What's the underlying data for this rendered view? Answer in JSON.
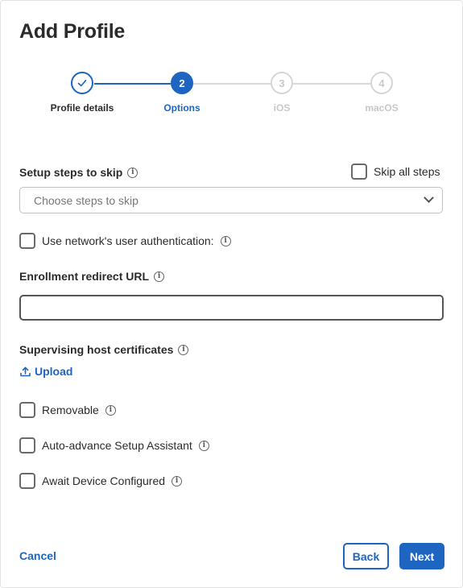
{
  "dialog": {
    "title": "Add Profile"
  },
  "stepper": {
    "steps": [
      {
        "number": "✓",
        "label": "Profile details",
        "state": "done"
      },
      {
        "number": "2",
        "label": "Options",
        "state": "current"
      },
      {
        "number": "3",
        "label": "iOS",
        "state": "pending"
      },
      {
        "number": "4",
        "label": "macOS",
        "state": "pending"
      }
    ]
  },
  "setup_steps": {
    "label": "Setup steps to skip",
    "skip_all_label": "Skip all steps",
    "placeholder": "Choose steps to skip"
  },
  "network_auth": {
    "label": "Use network's user authentication:"
  },
  "enrollment": {
    "label": "Enrollment redirect URL",
    "value": ""
  },
  "certificates": {
    "label": "Supervising host certificates",
    "upload_label": "Upload"
  },
  "options": {
    "removable": "Removable",
    "auto_advance": "Auto-advance Setup Assistant",
    "await_configured": "Await Device Configured"
  },
  "footer": {
    "cancel": "Cancel",
    "back": "Back",
    "next": "Next"
  },
  "colors": {
    "accent": "#1d65c1",
    "pending": "#d6d6d6"
  }
}
